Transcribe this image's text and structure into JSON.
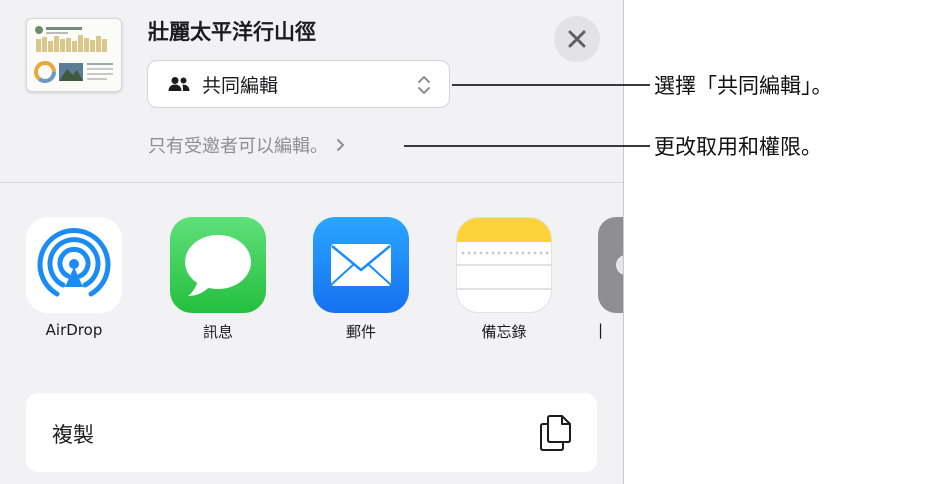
{
  "document": {
    "title": "壯麗太平洋行山徑"
  },
  "collaboration": {
    "mode_label": "共同編輯",
    "access_note": "只有受邀者可以編輯。"
  },
  "apps": [
    {
      "label": "AirDrop",
      "icon": "airdrop-icon"
    },
    {
      "label": "訊息",
      "icon": "messages-icon"
    },
    {
      "label": "郵件",
      "icon": "mail-icon"
    },
    {
      "label": "備忘錄",
      "icon": "notes-icon"
    }
  ],
  "actions": {
    "copy_label": "複製"
  },
  "callouts": {
    "collaborate": "選擇「共同編輯」。",
    "permissions": "更改取用和權限。"
  },
  "colors": {
    "messages_green": "#32c958",
    "mail_blue": "#1a8cff",
    "airdrop_blue": "#1c8cf5",
    "notes_yellow": "#fdd33c",
    "sheet_bg": "#f2f2f4"
  }
}
